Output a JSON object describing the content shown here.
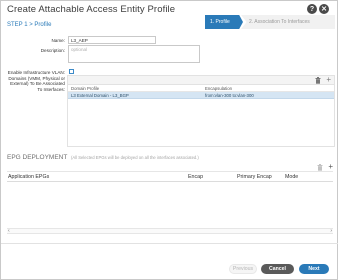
{
  "dialog": {
    "title": "Create Attachable Access Entity Profile",
    "help_icon": "?",
    "close_icon": "✕"
  },
  "step": {
    "label": "STEP 1 > Profile"
  },
  "wizard": {
    "steps": [
      {
        "label": "1. Profile",
        "active": true
      },
      {
        "label": "2. Association To Interfaces",
        "active": false
      }
    ]
  },
  "form": {
    "name_label": "Name:",
    "name_value": "L3_AEP",
    "description_label": "Description:",
    "description_placeholder": "optional",
    "infra_vlan_label": "Enable Infrastructure VLAN:",
    "domains_label_lines": [
      "Domains (VMM, Physical or",
      "External) To Be Associated",
      "To Interfaces:"
    ]
  },
  "domains_table": {
    "columns": [
      "Domain Profile",
      "Encapsulation"
    ],
    "rows": [
      {
        "domain_profile": "L3 External Domain - L3_BGP",
        "encapsulation": "from:vlan-300 to:vlan-300"
      }
    ]
  },
  "epg": {
    "title": "EPG DEPLOYMENT",
    "note": "(All Selected EPGs will be deployed on all the interfaces associated.)",
    "columns": [
      "Application EPGs",
      "Encap",
      "Primary Encap",
      "Mode"
    ]
  },
  "buttons": {
    "previous": "Previous",
    "cancel": "Cancel",
    "next": "Next"
  },
  "colors": {
    "accent": "#2a7ab8",
    "selected_row": "#d5e5f3",
    "cancel_bg": "#5a5a5a"
  },
  "icons": {
    "delete": "trash-icon",
    "add": "plus-icon"
  }
}
